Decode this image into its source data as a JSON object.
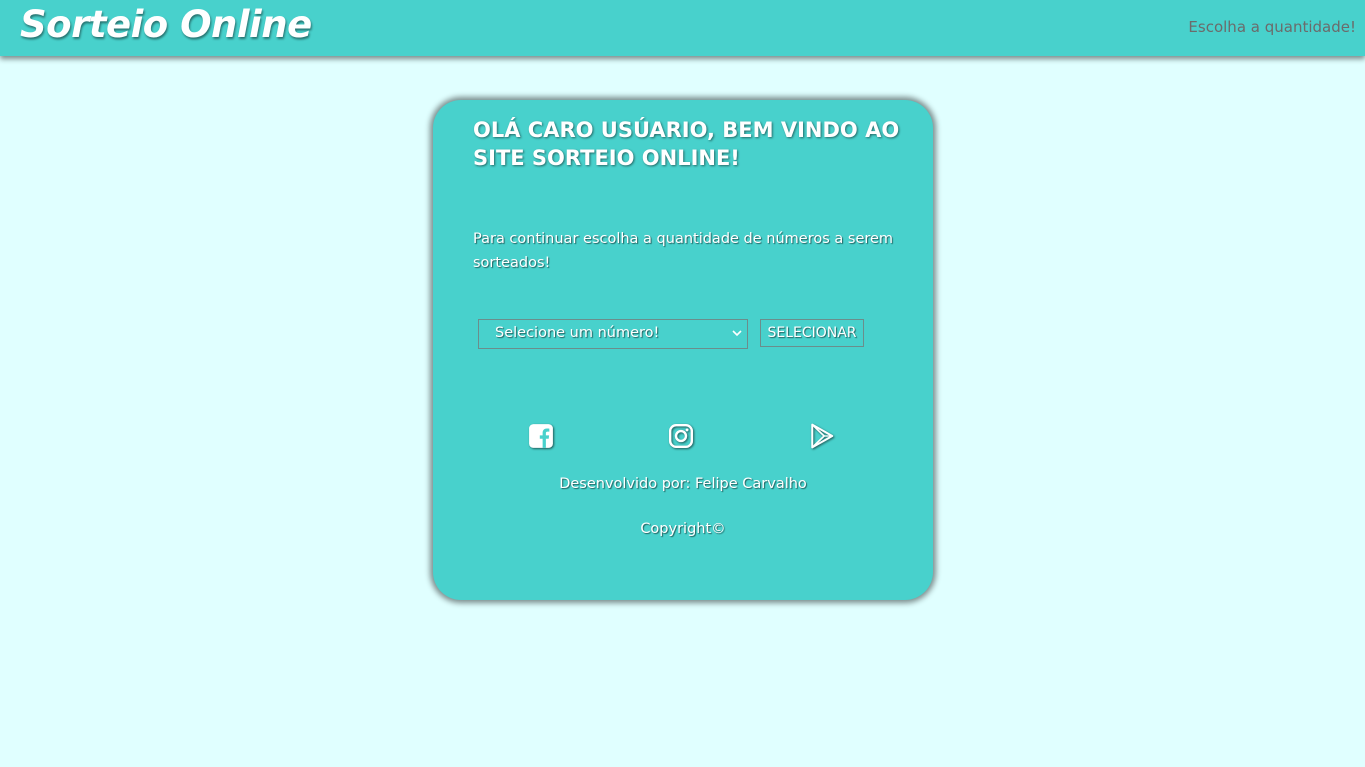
{
  "header": {
    "brand": "Sorteio Online",
    "nav_link": "Escolha a quantidade!"
  },
  "card": {
    "title": "OLÁ CARO USÚARIO, BEM VINDO AO SITE SORTEIO ONLINE!",
    "instructions": "Para continuar escolha a quantidade de números a serem sorteados!",
    "select": {
      "selected": "Selecione um número!"
    },
    "button_label": "SELECIONAR",
    "social": [
      {
        "icon": "facebook-icon"
      },
      {
        "icon": "instagram-icon"
      },
      {
        "icon": "google-play-icon"
      }
    ],
    "credit": "Desenvolvido por: Felipe Carvalho",
    "copyright": "Copyright©"
  },
  "colors": {
    "background": "#e0ffff",
    "accent": "#48d1cc",
    "text": "#ffffff",
    "nav_text": "#6b6b6b"
  }
}
